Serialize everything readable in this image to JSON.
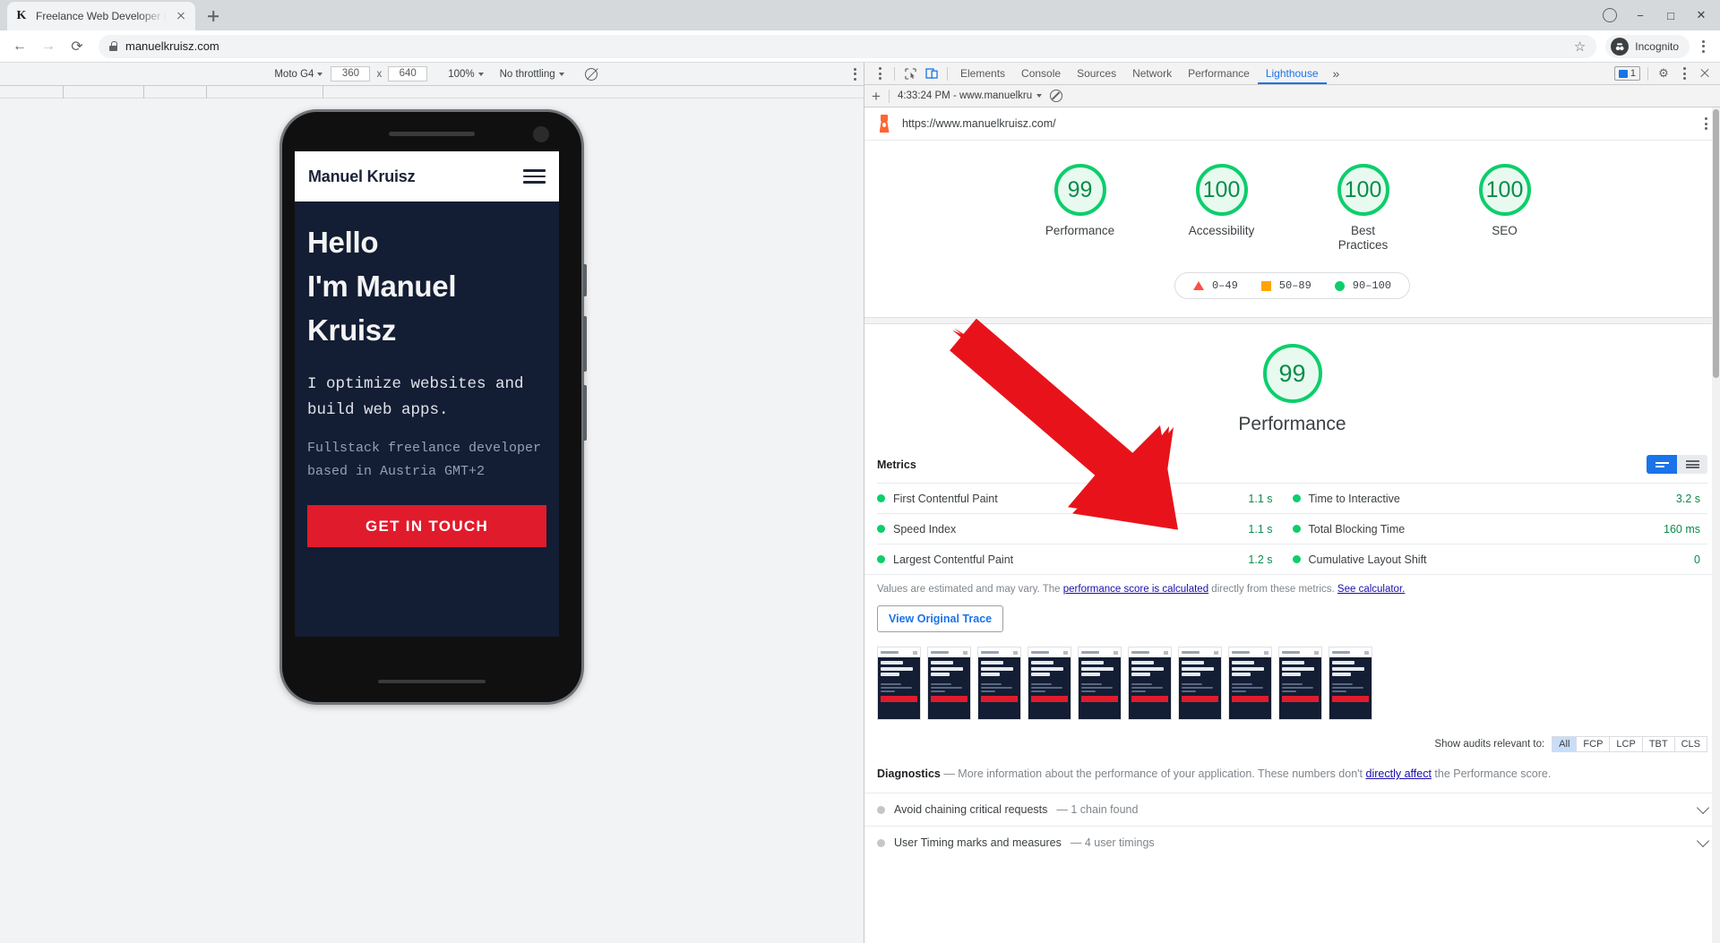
{
  "browser": {
    "tab": {
      "title": "Freelance Web Developer | Ma",
      "favicon": "K"
    },
    "new_tab_label": "+",
    "address": "manuelkruisz.com",
    "incognito_label": "Incognito",
    "window_controls": {
      "minimize": "−",
      "maximize": "□",
      "close": "✕"
    },
    "nav": {
      "back": "←",
      "forward": "→",
      "reload": "⟳"
    },
    "bookmark_star": "☆"
  },
  "device_toolbar": {
    "device": "Moto G4",
    "width": "360",
    "height": "640",
    "x_label": "x",
    "zoom": "100%",
    "throttling": "No throttling"
  },
  "site": {
    "logo": "Manuel Kruisz",
    "headline_lines": [
      "Hello",
      "I'm Manuel",
      "Kruisz"
    ],
    "subhead": "I optimize websites and build web apps.",
    "description": "Fullstack freelance developer based in Austria GMT+2",
    "cta": "GET IN TOUCH"
  },
  "devtools": {
    "tabs": [
      {
        "label": "Elements",
        "active": false
      },
      {
        "label": "Console",
        "active": false
      },
      {
        "label": "Sources",
        "active": false
      },
      {
        "label": "Network",
        "active": false
      },
      {
        "label": "Performance",
        "active": false
      },
      {
        "label": "Lighthouse",
        "active": true
      }
    ],
    "more_tabs": "»",
    "message_count": "1",
    "settings_icon": "⚙",
    "close_icon": "close-icon"
  },
  "lighthouse": {
    "toolbar": {
      "add": "+",
      "report_selector": "4:33:24 PM - www.manuelkrui",
      "clear_icon": "no-entry-icon"
    },
    "url": "https://www.manuelkruisz.com/",
    "scores": [
      {
        "value": "99",
        "label": "Performance"
      },
      {
        "value": "100",
        "label": "Accessibility"
      },
      {
        "value": "100",
        "label": "Best Practices"
      },
      {
        "value": "100",
        "label": "SEO"
      }
    ],
    "legend": [
      {
        "shape": "triangle",
        "color": "#ff4e42",
        "range": "0–49"
      },
      {
        "shape": "square",
        "color": "#ffa400",
        "range": "50–89"
      },
      {
        "shape": "circle",
        "color": "#0cce6b",
        "range": "90–100"
      }
    ],
    "performance": {
      "score": "99",
      "label": "Performance"
    },
    "metrics_title": "Metrics",
    "metrics": [
      {
        "name": "First Contentful Paint",
        "value": "1.1 s",
        "status": "pass"
      },
      {
        "name": "Time to Interactive",
        "value": "3.2 s",
        "status": "pass"
      },
      {
        "name": "Speed Index",
        "value": "1.1 s",
        "status": "pass"
      },
      {
        "name": "Total Blocking Time",
        "value": "160 ms",
        "status": "pass"
      },
      {
        "name": "Largest Contentful Paint",
        "value": "1.2 s",
        "status": "pass"
      },
      {
        "name": "Cumulative Layout Shift",
        "value": "0",
        "status": "pass"
      }
    ],
    "metrics_note": {
      "pre": "Values are estimated and may vary. The ",
      "link1": "performance score is calculated",
      "mid": " directly from these metrics. ",
      "link2": "See calculator."
    },
    "view_trace_button": "View Original Trace",
    "filmstrip_count": 10,
    "audit_filter": {
      "label": "Show audits relevant to:",
      "options": [
        "All",
        "FCP",
        "LCP",
        "TBT",
        "CLS"
      ],
      "selected": "All"
    },
    "diagnostics": {
      "title": "Diagnostics",
      "pre": " — More information about the performance of your application. These numbers don't ",
      "link": "directly affect",
      "post": " the Performance score."
    },
    "audits": [
      {
        "name": "Avoid chaining critical requests",
        "detail": "— 1 chain found"
      },
      {
        "name": "User Timing marks and measures",
        "detail": "— 4 user timings"
      }
    ]
  },
  "colors": {
    "pass_green": "#0cce6b",
    "average_orange": "#ffa400",
    "fail_red": "#ff4e42",
    "accent_blue": "#1a73e8",
    "site_navy": "#131d33",
    "site_red": "#e01b2c",
    "annotation_red": "#e8131a"
  }
}
